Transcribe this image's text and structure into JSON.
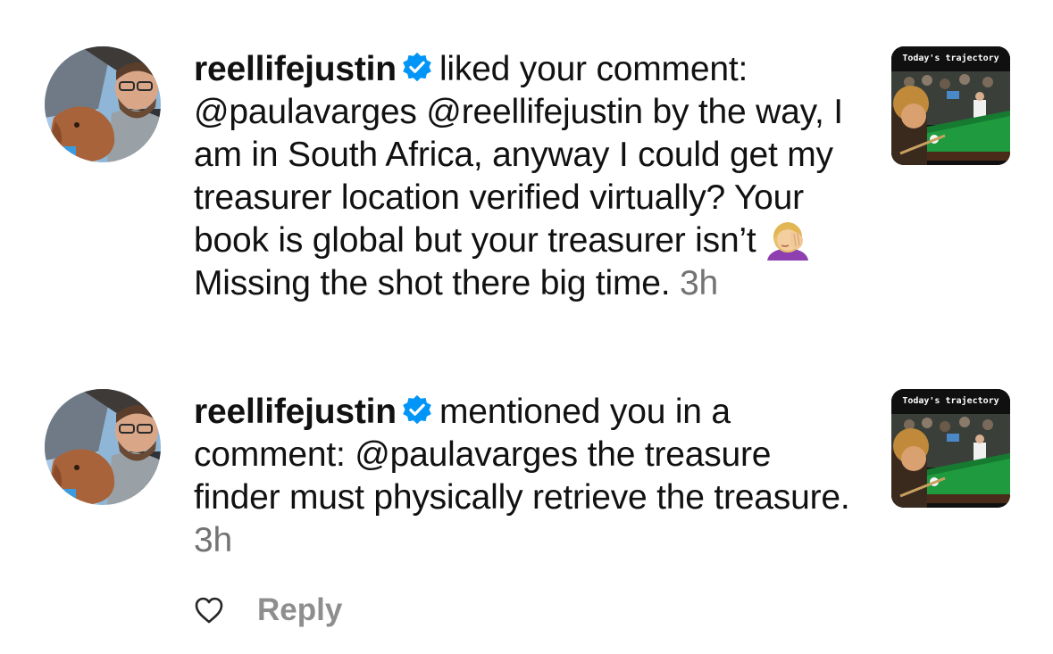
{
  "notifications": [
    {
      "username": "reellifejustin",
      "verified": true,
      "avatar_icon": "profile-photo",
      "action": "liked your comment:",
      "comment_part1": "@paulavarges @reellifejustin by the way, I am in South Africa, anyway I could get my treasurer location verified virtually? Your book is global but your treasurer isn’t",
      "emoji_icon": "woman-facepalming-emoji",
      "comment_part2": "Missing the shot there big time.",
      "time": "3h",
      "thumbnail_caption": "Today's trajectory"
    },
    {
      "username": "reellifejustin",
      "verified": true,
      "avatar_icon": "profile-photo",
      "action": "mentioned you in a comment:",
      "comment": "@paulavarges the treasure finder must physically retrieve the treasure.",
      "time": "3h",
      "thumbnail_caption": "Today's trajectory"
    }
  ],
  "actions": {
    "like_icon": "heart-outline-icon",
    "reply_label": "Reply"
  },
  "colors": {
    "text": "#111111",
    "timestamp": "#737373",
    "reply": "#8e8e8e",
    "verified_badge": "#0095f6"
  }
}
